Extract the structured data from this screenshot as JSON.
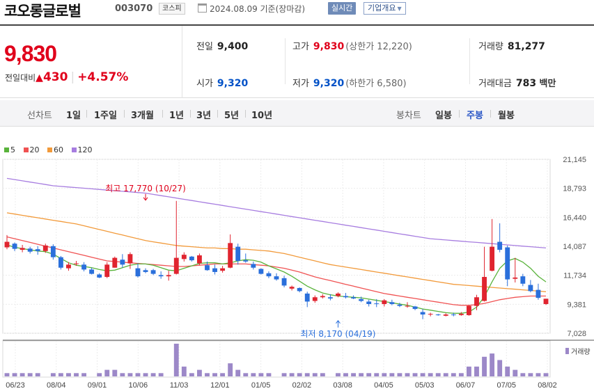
{
  "header": {
    "stock_name": "코오롱글로벌",
    "stock_code": "003070",
    "market": "코스피",
    "date_text": "2024.08.09 기준(장마감)",
    "realtime_button": "실시간",
    "company_overview_button": "기업개요",
    "icons": [
      "calendar-icon",
      "dropdown-caret-icon"
    ]
  },
  "quote": {
    "price": "9,830",
    "change_label": "전일대비",
    "change_arrow": "▲",
    "change_value": "430",
    "change_rate": "+4.57%",
    "prev_close": {
      "label": "전일",
      "value": "9,400"
    },
    "open": {
      "label": "시가",
      "value": "9,320"
    },
    "high": {
      "label": "고가",
      "value": "9,830",
      "limit": "(상한가 12,220)"
    },
    "low": {
      "label": "저가",
      "value": "9,320",
      "limit": "(하한가 6,580)"
    },
    "volume": {
      "label": "거래량",
      "value": "81,277"
    },
    "trade_amount": {
      "label": "거래대금",
      "value": "783",
      "unit": "백만"
    }
  },
  "period_bar": {
    "line_chart_title": "선차트",
    "line_periods": [
      "1일",
      "1주일",
      "3개월",
      "1년",
      "3년",
      "5년",
      "10년"
    ],
    "candle_chart_title": "봉차트",
    "candle_periods": [
      "일봉",
      "주봉",
      "월봉"
    ],
    "active_candle_period": "주봉"
  },
  "chart_data": {
    "type": "candlestick",
    "legend": [
      {
        "name": "5",
        "color": "#59b33b"
      },
      {
        "name": "20",
        "color": "#f05252"
      },
      {
        "name": "60",
        "color": "#f29a3a"
      },
      {
        "name": "120",
        "color": "#a77de0"
      }
    ],
    "y_ticks": [
      "21,145",
      "18,793",
      "16,440",
      "14,087",
      "11,734",
      "9,381",
      "7,028"
    ],
    "y_range": [
      7028,
      21145
    ],
    "x_ticks": [
      "06/23",
      "08/04",
      "09/01",
      "10/06",
      "11/03",
      "12/01",
      "01/05",
      "02/02",
      "03/08",
      "04/05",
      "05/03",
      "06/07",
      "07/05",
      "08/02"
    ],
    "annotations": {
      "high": {
        "text": "최고 17,770 (10/27)",
        "value": 17770,
        "bar_index": 18
      },
      "low": {
        "text": "최저 8,170 (04/19)",
        "value": 8170,
        "bar_index": 43
      }
    },
    "volume_label": "거래량",
    "colors": {
      "up": "#e0242f",
      "down": "#2a6fdb",
      "volume": "#9c88c8"
    },
    "candles": [
      [
        14000,
        15000,
        13850,
        14450
      ],
      [
        14300,
        14400,
        13700,
        13880
      ],
      [
        13800,
        14200,
        13600,
        13950
      ],
      [
        13900,
        14050,
        13500,
        13650
      ],
      [
        13850,
        14100,
        13400,
        13700
      ],
      [
        13700,
        14300,
        13550,
        14150
      ],
      [
        14100,
        14250,
        13000,
        13200
      ],
      [
        13200,
        13300,
        12200,
        12350
      ],
      [
        12300,
        12800,
        12100,
        12600
      ],
      [
        12700,
        12900,
        12500,
        12700
      ],
      [
        12600,
        12800,
        12050,
        12200
      ],
      [
        12200,
        12350,
        11800,
        11850
      ],
      [
        11800,
        11900,
        11500,
        11550
      ],
      [
        11600,
        12800,
        11500,
        12600
      ],
      [
        12350,
        13250,
        12350,
        13150
      ],
      [
        13000,
        13450,
        12350,
        12600
      ],
      [
        12700,
        13600,
        12250,
        13450
      ],
      [
        12300,
        12700,
        11550,
        11650
      ],
      [
        12150,
        12300,
        11900,
        12000
      ],
      [
        12150,
        12250,
        11750,
        11850
      ],
      [
        11750,
        12050,
        11450,
        11650
      ],
      [
        11650,
        12100,
        11300,
        11750
      ],
      [
        11850,
        17770,
        11800,
        13150
      ],
      [
        13050,
        13600,
        12850,
        13400
      ],
      [
        13250,
        13300,
        12850,
        12950
      ],
      [
        12700,
        13500,
        12550,
        13350
      ],
      [
        12550,
        12850,
        12100,
        12150
      ],
      [
        12300,
        12600,
        11800,
        12000
      ],
      [
        12100,
        12500,
        11950,
        12300
      ],
      [
        12350,
        15050,
        12300,
        14350
      ],
      [
        14050,
        14300,
        12600,
        12900
      ],
      [
        12950,
        13500,
        12750,
        12850
      ],
      [
        12650,
        12850,
        12200,
        12350
      ],
      [
        12250,
        12300,
        11800,
        11850
      ],
      [
        11900,
        12050,
        11500,
        11650
      ],
      [
        11650,
        11900,
        11300,
        11400
      ],
      [
        11500,
        11700,
        10750,
        10900
      ],
      [
        10650,
        10900,
        10500,
        10800
      ],
      [
        10700,
        10750,
        10350,
        10450
      ],
      [
        10250,
        10400,
        9150,
        9600
      ],
      [
        9650,
        10100,
        9500,
        9950
      ],
      [
        9950,
        10200,
        9850,
        10050
      ],
      [
        9950,
        10200,
        9700,
        9850
      ],
      [
        10050,
        10350,
        9950,
        10250
      ],
      [
        10050,
        10300,
        9850,
        9950
      ],
      [
        9950,
        10100,
        9800,
        9850
      ],
      [
        9800,
        10000,
        9550,
        9650
      ],
      [
        9600,
        9750,
        9200,
        9400
      ],
      [
        9450,
        9800,
        9150,
        9400
      ],
      [
        9400,
        9800,
        9200,
        9700
      ],
      [
        9550,
        9750,
        9300,
        9400
      ],
      [
        9350,
        9500,
        9150,
        9250
      ],
      [
        9200,
        9550,
        9100,
        9250
      ],
      [
        9200,
        9250,
        8900,
        9000
      ],
      [
        8750,
        9000,
        8170,
        8550
      ],
      [
        8600,
        8700,
        8400,
        8600
      ],
      [
        8550,
        8600,
        8450,
        8500
      ],
      [
        8450,
        8650,
        8400,
        8550
      ],
      [
        8550,
        8700,
        8400,
        8500
      ],
      [
        8500,
        8750,
        8450,
        8600
      ],
      [
        8500,
        9300,
        8450,
        9250
      ],
      [
        9250,
        10150,
        8900,
        9950
      ],
      [
        9650,
        14050,
        9600,
        11600
      ],
      [
        12100,
        16300,
        12050,
        14050
      ],
      [
        14450,
        15950,
        13600,
        13800
      ],
      [
        14000,
        14150,
        10850,
        11400
      ],
      [
        11450,
        13150,
        11150,
        11550
      ],
      [
        11650,
        11850,
        10850,
        11050
      ],
      [
        10950,
        11350,
        10350,
        10450
      ],
      [
        10550,
        11050,
        9750,
        9900
      ],
      [
        9400,
        9830,
        9320,
        9830
      ]
    ],
    "ma5": [
      14200,
      14000,
      13900,
      13800,
      13700,
      13650,
      13450,
      13100,
      12750,
      12550,
      12450,
      12350,
      12200,
      12100,
      12150,
      12350,
      12550,
      12650,
      12650,
      12550,
      12350,
      12150,
      12100,
      12300,
      12500,
      12700,
      12750,
      12750,
      12650,
      12750,
      12900,
      13000,
      12950,
      12800,
      12500,
      12250,
      12000,
      11650,
      11250,
      10850,
      10550,
      10300,
      10150,
      10050,
      10000,
      9950,
      9900,
      9800,
      9700,
      9600,
      9500,
      9400,
      9300,
      9150,
      9000,
      8900,
      8800,
      8700,
      8650,
      8650,
      8750,
      9150,
      10000,
      11200,
      12300,
      12900,
      13100,
      12800,
      12300,
      11650,
      11200
    ],
    "ma20": [
      14850,
      14700,
      14550,
      14400,
      14250,
      14100,
      13950,
      13800,
      13650,
      13500,
      13350,
      13200,
      13050,
      12900,
      12850,
      12800,
      12750,
      12700,
      12650,
      12600,
      12550,
      12500,
      12450,
      12450,
      12500,
      12550,
      12600,
      12650,
      12650,
      12650,
      12650,
      12650,
      12600,
      12550,
      12500,
      12400,
      12300,
      12150,
      12000,
      11800,
      11600,
      11450,
      11300,
      11150,
      11000,
      10850,
      10700,
      10550,
      10400,
      10250,
      10150,
      10050,
      9950,
      9850,
      9750,
      9650,
      9550,
      9450,
      9350,
      9300,
      9300,
      9350,
      9450,
      9600,
      9750,
      9850,
      9950,
      10000,
      10050,
      10050,
      10050
    ],
    "ma60": [
      16800,
      16700,
      16600,
      16500,
      16400,
      16300,
      16200,
      16100,
      16000,
      15900,
      15750,
      15600,
      15450,
      15300,
      15150,
      15000,
      14850,
      14700,
      14550,
      14450,
      14350,
      14250,
      14150,
      14100,
      14050,
      14000,
      13950,
      13950,
      13900,
      13900,
      13850,
      13850,
      13800,
      13750,
      13700,
      13600,
      13500,
      13350,
      13200,
      13050,
      12900,
      12750,
      12600,
      12500,
      12400,
      12300,
      12200,
      12100,
      12000,
      11900,
      11800,
      11700,
      11600,
      11500,
      11400,
      11300,
      11200,
      11100,
      11000,
      10950,
      10900,
      10850,
      10800,
      10750,
      10700,
      10650,
      10600,
      10550,
      10500,
      10450,
      10400
    ],
    "ma120": [
      19600,
      19500,
      19400,
      19300,
      19200,
      19100,
      19000,
      18950,
      18900,
      18850,
      18800,
      18750,
      18700,
      18650,
      18600,
      18550,
      18500,
      18450,
      18400,
      18300,
      18200,
      18100,
      18000,
      17900,
      17800,
      17700,
      17600,
      17500,
      17400,
      17300,
      17200,
      17100,
      17000,
      16900,
      16800,
      16700,
      16600,
      16500,
      16400,
      16300,
      16200,
      16100,
      16000,
      15900,
      15800,
      15700,
      15600,
      15500,
      15400,
      15300,
      15200,
      15100,
      15000,
      14900,
      14800,
      14700,
      14650,
      14600,
      14550,
      14500,
      14450,
      14400,
      14350,
      14300,
      14250,
      14200,
      14150,
      14100,
      14050,
      14000,
      13950
    ],
    "volumes": [
      1,
      1,
      1,
      1,
      1,
      0,
      1,
      1,
      1,
      1,
      1,
      0,
      1,
      2,
      2,
      1,
      1,
      1,
      1,
      1,
      1,
      0,
      10,
      3,
      1,
      2,
      1,
      1,
      1,
      4,
      2,
      1,
      1,
      1,
      1,
      0,
      1,
      1,
      1,
      1,
      1,
      1,
      0,
      1,
      1,
      1,
      1,
      1,
      1,
      1,
      1,
      1,
      1,
      1,
      1,
      1,
      1,
      1,
      1,
      1,
      3,
      3,
      6,
      7,
      5,
      3,
      2,
      1,
      1,
      1,
      1
    ]
  }
}
